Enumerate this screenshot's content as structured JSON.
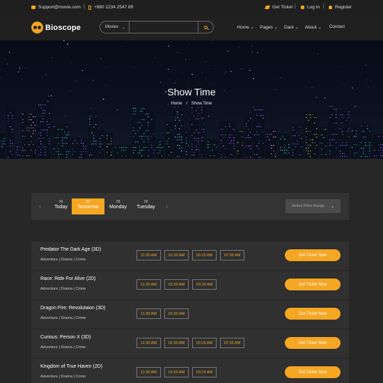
{
  "topbar": {
    "email": "Support@movie.com",
    "phone": "+880 1234 2547 89",
    "get_ticket": "Get Ticket",
    "login": "Log In",
    "register": "Register",
    "separator": "|"
  },
  "header": {
    "logo_text": "Bioscope",
    "search_category": "Movies",
    "search_placeholder": "",
    "nav": [
      "Home",
      "Pages",
      "Dark",
      "About",
      "Contact"
    ],
    "nav_chevron": "⌄"
  },
  "banner": {
    "title": "Show Time",
    "breadcrumb_home": "Home",
    "breadcrumb_sep": "/",
    "breadcrumb_current": "Show Time"
  },
  "filter": {
    "prev_arrow": "‹",
    "next_arrow": "›",
    "days": [
      {
        "num": "26",
        "name": "Today",
        "active": false
      },
      {
        "num": "27",
        "name": "Tomorrow",
        "active": true
      },
      {
        "num": "28",
        "name": "Monday",
        "active": false
      },
      {
        "num": "29",
        "name": "Tuesday",
        "active": false
      }
    ],
    "price_placeholder": "Select Price Range",
    "price_chevron": "⌄"
  },
  "showtimes": {
    "button_label": "Get Ticket Now",
    "rows": [
      {
        "title": "Predator The Dark Age (3D)",
        "genre": "Adventure | Drama | Crime",
        "times": [
          "11:30 AM",
          "01:50 AM",
          "03:15 AM",
          "07:35 AM"
        ]
      },
      {
        "title": "Race: Ride For Alive (2D)",
        "genre": "Adventure | Drama | Crime",
        "times": [
          "11:30 AM",
          "01:50 AM",
          "03:15 AM"
        ]
      },
      {
        "title": "Dragon Fire: Revolutaion (3D)",
        "genre": "Adventure | Drama | Crime",
        "times": [
          "11:30 AM",
          "01:50 AM"
        ]
      },
      {
        "title": "Curious: Person X (3D)",
        "genre": "Adventure | Drama | Crime",
        "times": [
          "11:30 AM",
          "01:50 AM",
          "03:15 AM",
          "07:35 AM"
        ]
      },
      {
        "title": "Kingdom of True Haven (2D)",
        "genre": "Adventure | Drama | Crime",
        "times": [
          "11:30 AM",
          "01:50 AM",
          "03:15 AM"
        ]
      }
    ]
  },
  "colors": {
    "accent": "#f5a623",
    "background": "#272727",
    "panel": "#303030"
  }
}
